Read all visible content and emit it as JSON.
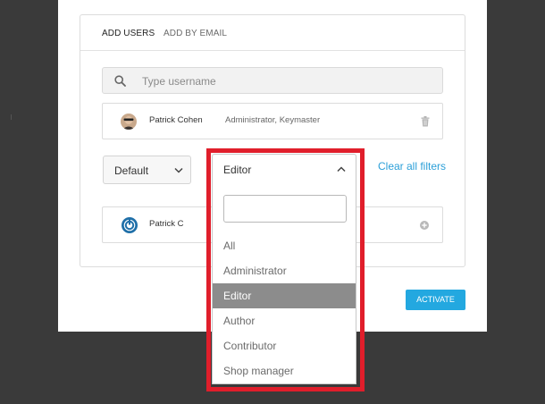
{
  "tabs": [
    {
      "label": "ADD USERS",
      "active": true
    },
    {
      "label": "ADD BY EMAIL",
      "active": false
    }
  ],
  "search": {
    "placeholder": "Type username"
  },
  "selected_users": [
    {
      "name": "Patrick Cohen",
      "roles": "Administrator, Keymaster",
      "action_icon": "trash-icon"
    }
  ],
  "filters": {
    "default_select": "Default",
    "role_select": "Editor",
    "clear_label": "Clear all filters"
  },
  "role_dropdown": {
    "search_value": "",
    "options": [
      "All",
      "Administrator",
      "Editor",
      "Author",
      "Contributor",
      "Shop manager"
    ],
    "selected": "Editor"
  },
  "results": [
    {
      "name": "Patrick C",
      "action_icon": "add-icon"
    }
  ],
  "activate_label": "ACTIVATE",
  "colors": {
    "accent": "#23a8e0",
    "link": "#2b9fd8",
    "highlight_frame": "#e01e2b",
    "selected_option_bg": "#8c8c8c",
    "overlay": "#3a3a3a"
  }
}
